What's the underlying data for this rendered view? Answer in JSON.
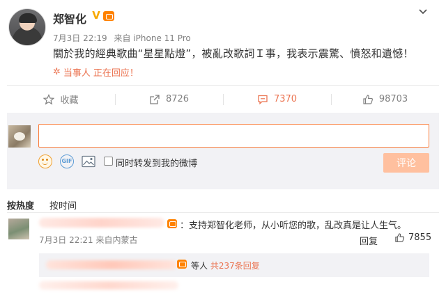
{
  "post": {
    "author_name": "郑智化",
    "time": "7月3日 22:19",
    "source": "来自 iPhone 11 Pro",
    "text": "關於我的經典歌曲“星星點燈”，被亂改歌詞Ｉ事，我表示震驚、憤怒和遺憾！",
    "party_label": "当事人",
    "party_status": "正在回应！"
  },
  "actions": {
    "favorite": {
      "label": "收藏",
      "icon": "star-icon"
    },
    "repost": {
      "count": "8726",
      "icon": "share-icon"
    },
    "comment": {
      "count": "7370",
      "icon": "comment-icon"
    },
    "like": {
      "count": "98703",
      "icon": "thumbs-up-icon"
    }
  },
  "composer": {
    "input_value": "",
    "forward_label": "同时转发到我的微博",
    "submit_label": "评论",
    "gif_label": "GIF"
  },
  "sort": {
    "hot_label": "按热度",
    "time_label": "按时间"
  },
  "comment": {
    "text": "：支持郑智化老师，从小听您的歌，乱改真是让人生气。",
    "time": "7月3日 22:21",
    "source": "来自内蒙古",
    "reply_label": "回复",
    "likes": "7855"
  },
  "replies": {
    "prefix": "等人",
    "count_label": "共237条回复"
  },
  "colors": {
    "accent": "#eb7350",
    "input_border": "#fa7d3c",
    "submit_bg": "#ffc09f",
    "composer_bg": "#f2f2f5"
  }
}
